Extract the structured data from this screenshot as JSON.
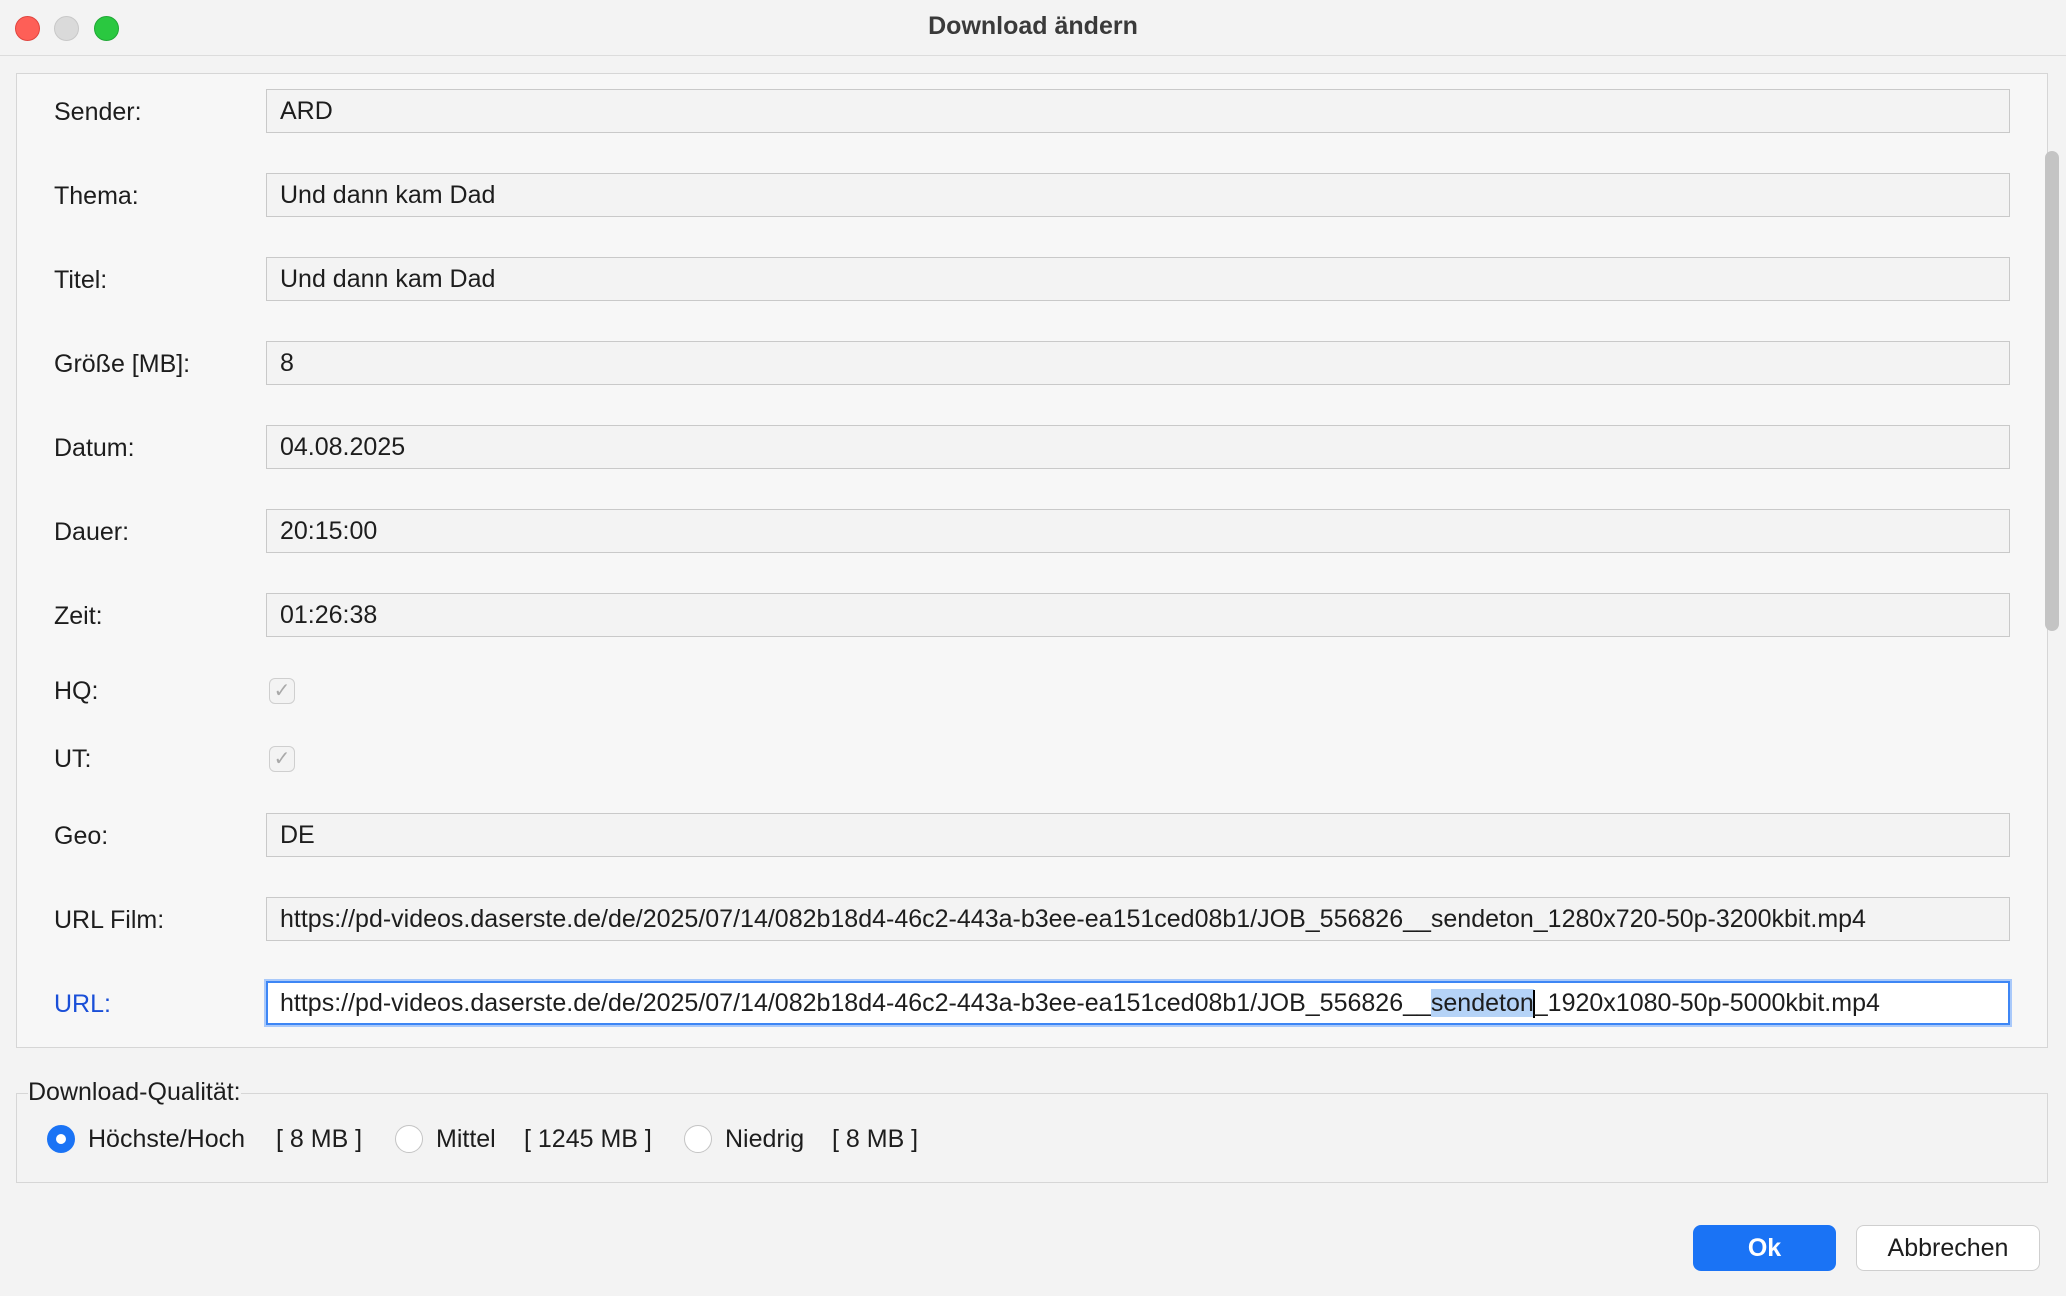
{
  "window": {
    "title": "Download ändern"
  },
  "fields": {
    "sender": {
      "label": "Sender:",
      "value": "ARD"
    },
    "thema": {
      "label": "Thema:",
      "value": "Und dann kam Dad"
    },
    "titel": {
      "label": "Titel:",
      "value": "Und dann kam Dad"
    },
    "groesse": {
      "label": "Größe [MB]:",
      "value": "8"
    },
    "datum": {
      "label": "Datum:",
      "value": "04.08.2025"
    },
    "dauer": {
      "label": "Dauer:",
      "value": "20:15:00"
    },
    "zeit": {
      "label": "Zeit:",
      "value": "01:26:38"
    },
    "hq": {
      "label": "HQ:",
      "checked": true
    },
    "ut": {
      "label": "UT:",
      "checked": true
    },
    "geo": {
      "label": "Geo:",
      "value": "DE"
    },
    "url_film": {
      "label": "URL Film:",
      "value": "https://pd-videos.daserste.de/de/2025/07/14/082b18d4-46c2-443a-b3ee-ea151ced08b1/JOB_556826__sendeton_1280x720-50p-3200kbit.mp4"
    },
    "url": {
      "label": "URL:",
      "value_before": "https://pd-videos.daserste.de/de/2025/07/14/082b18d4-46c2-443a-b3ee-ea151ced08b1/JOB_556826__",
      "value_selected": "sendeton",
      "value_after": "_1920x1080-50p-5000kbit.mp4"
    }
  },
  "quality": {
    "legend": "Download-Qualität:",
    "options": [
      {
        "label": "Höchste/Hoch",
        "size": "[ 8 MB ]",
        "checked": true
      },
      {
        "label": "Mittel",
        "size": "[ 1245 MB ]",
        "checked": false
      },
      {
        "label": "Niedrig",
        "size": "[ 8 MB ]",
        "checked": false
      }
    ]
  },
  "buttons": {
    "ok": "Ok",
    "cancel": "Abbrechen"
  },
  "colors": {
    "accent": "#1a73f5",
    "focus_ring": "#3d86f5",
    "active_label": "#1a4fd8"
  }
}
